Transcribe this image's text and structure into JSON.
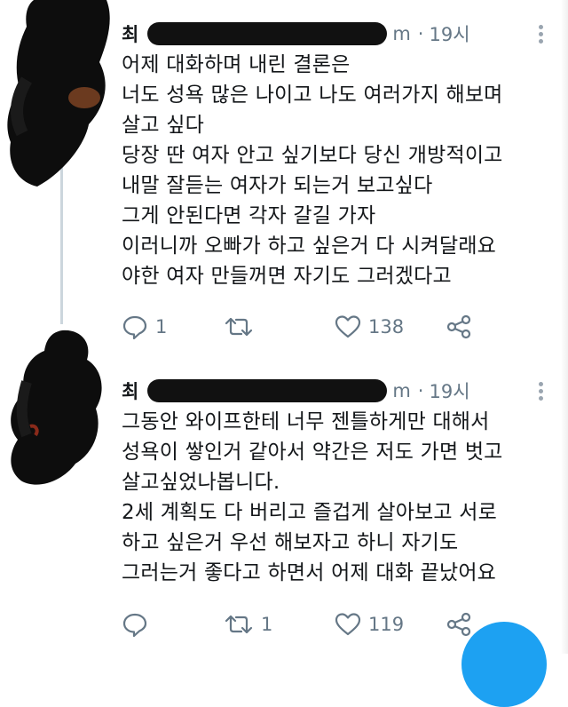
{
  "tweets": [
    {
      "name": "최",
      "handle": "m",
      "separator": "·",
      "time": "19시",
      "lines": [
        "어제 대화하며 내린 결론은",
        "너도 성욕 많은 나이고 나도 여러가지 해보며",
        "살고 싶다",
        "당장 딴 여자 안고 싶기보다 당신 개방적이고",
        "내말 잘듣는 여자가 되는거 보고싶다",
        "그게 안된다면 각자 갈길 가자",
        "이러니까 오빠가 하고 싶은거 다 시켜달래요",
        "야한 여자 만들꺼면 자기도 그러겠다고"
      ],
      "reply_count": "1",
      "retweet_count": "",
      "like_count": "138"
    },
    {
      "name": "최",
      "handle": "m",
      "separator": "·",
      "time": "19시",
      "lines": [
        "그동안 와이프한테 너무 젠틀하게만 대해서",
        "성욕이 쌓인거 같아서 약간은 저도 가면 벗고",
        "살고싶었나봅니다.",
        "2세 계획도 다 버리고 즐겁게 살아보고 서로",
        "하고 싶은거 우선 해보자고 하니 자기도",
        "그러는거 좋다고 하면서 어제 대화 끝났어요"
      ],
      "reply_count": "",
      "retweet_count": "1",
      "like_count": "119"
    }
  ],
  "icons": {
    "reply": "reply-icon",
    "retweet": "retweet-icon",
    "like": "like-icon",
    "share": "share-icon",
    "more": "more-icon"
  },
  "colors": {
    "text": "#14171a",
    "muted": "#657786",
    "thread_line": "#ccd6dd",
    "accent": "#1da1f2"
  }
}
